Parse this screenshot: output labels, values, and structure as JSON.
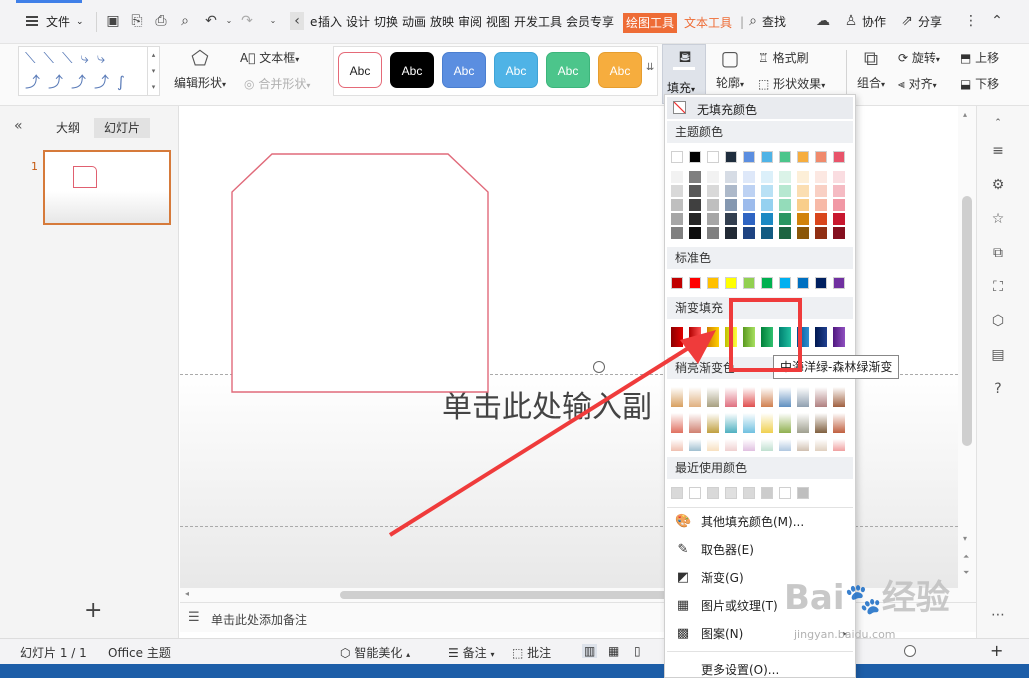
{
  "menubar": {
    "file_label": "文件",
    "tabs": [
      "插入",
      "设计",
      "切换",
      "动画",
      "放映",
      "审阅",
      "视图",
      "开发工具",
      "会员专享"
    ],
    "active_tab": "绘图工具",
    "text_tool_tab": "文本工具",
    "search_label": "查找",
    "collab_label": "协作",
    "share_label": "分享"
  },
  "ribbon": {
    "edit_shape_label": "编辑形状",
    "textbox_label": "文本框",
    "merge_shape_label": "合并形状",
    "style_buttons": [
      {
        "label": "Abc",
        "bg": "#ffffff",
        "color": "#222222",
        "border": "#e56a78"
      },
      {
        "label": "Abc",
        "bg": "#000000",
        "color": "#ffffff",
        "border": "#000000"
      },
      {
        "label": "Abc",
        "bg": "#5b8ee0",
        "color": "#ffffff",
        "border": "#4a7ed0"
      },
      {
        "label": "Abc",
        "bg": "#4fb3e6",
        "color": "#ffffff",
        "border": "#3fa3d6"
      },
      {
        "label": "Abc",
        "bg": "#4cc58b",
        "color": "#ffffff",
        "border": "#3cb57b"
      },
      {
        "label": "Abc",
        "bg": "#f6ad3e",
        "color": "#ffffff",
        "border": "#e69d2e"
      }
    ],
    "fill_label": "填充",
    "outline_label": "轮廓",
    "format_painter_label": "格式刷",
    "shape_effect_label": "形状效果",
    "group_label": "组合",
    "rotate_label": "旋转",
    "align_label": "对齐",
    "bring_up_label": "上移",
    "send_down_label": "下移"
  },
  "left_panel": {
    "outline_tab": "大纲",
    "slides_tab": "幻灯片",
    "slide_number": "1"
  },
  "canvas": {
    "subtitle_placeholder": "单击此处输入副"
  },
  "notes": {
    "placeholder": "单击此处添加备注"
  },
  "statusbar": {
    "slide_count": "幻灯片 1 / 1",
    "theme": "Office 主题",
    "smart_beautify": "智能美化",
    "notes_label": "备注",
    "comments_label": "批注"
  },
  "fill_menu": {
    "no_fill": "无填充颜色",
    "theme_colors_header": "主题颜色",
    "theme_top_row": [
      "#ffffff",
      "#000000",
      "#ffffff",
      "#1f2d3d",
      "#5b8ee0",
      "#4fb3e6",
      "#4cc58b",
      "#f6ad3e",
      "#f08a6c",
      "#e8546a"
    ],
    "theme_columns": [
      [
        "#f2f2f2",
        "#d9d9d9",
        "#bfbfbf",
        "#a6a6a6",
        "#808080"
      ],
      [
        "#7f7f7f",
        "#595959",
        "#404040",
        "#262626",
        "#0d0d0d"
      ],
      [
        "#f2f2f2",
        "#d9d9d9",
        "#bfbfbf",
        "#a6a6a6",
        "#808080"
      ],
      [
        "#d6dce5",
        "#adb9ca",
        "#8497b0",
        "#333f50",
        "#222a35"
      ],
      [
        "#dee8f9",
        "#bdd2f3",
        "#9cbbec",
        "#2e64c3",
        "#1e4382"
      ],
      [
        "#dcf0fa",
        "#b9e1f5",
        "#95d1f0",
        "#1b89c3",
        "#125b82"
      ],
      [
        "#dbf3e8",
        "#b7e8d1",
        "#94dcba",
        "#2a9662",
        "#1c6441"
      ],
      [
        "#fdefd8",
        "#fbdeb2",
        "#f9ce8b",
        "#d1820a",
        "#8b5707"
      ],
      [
        "#fce8e2",
        "#f9d0c4",
        "#f7b9a7",
        "#d9461c",
        "#912f13"
      ],
      [
        "#fadde1",
        "#f5bbc3",
        "#f198a5",
        "#c8182f",
        "#85101f"
      ]
    ],
    "standard_header": "标准色",
    "standard_colors": [
      "#c00000",
      "#ff0000",
      "#ffc000",
      "#ffff00",
      "#92d050",
      "#00b050",
      "#00b0f0",
      "#0070c0",
      "#002060",
      "#7030a0"
    ],
    "gradient_header": "渐变填充",
    "gradient_colors": [
      [
        "#8b0000",
        "#e00000"
      ],
      [
        "#b00000",
        "#ff5050"
      ],
      [
        "#d08000",
        "#ffd000"
      ],
      [
        "#c0c000",
        "#ffff40"
      ],
      [
        "#5a9a20",
        "#a8e060"
      ],
      [
        "#00803a",
        "#30c070"
      ],
      [
        "#008070",
        "#20c0a0"
      ],
      [
        "#005090",
        "#3090d0"
      ],
      [
        "#001850",
        "#204090"
      ],
      [
        "#501880",
        "#9050c0"
      ]
    ],
    "light_gradient_header": "稍亮渐变色",
    "light_gradient_rows": [
      [
        "#d8a060",
        "#e0b080",
        "#a8a080",
        "#e07080",
        "#e05050",
        "#d08050",
        "#6090c0",
        "#90a0b0",
        "#b08080",
        "#a06040"
      ],
      [
        "#e07060",
        "#d08070",
        "#c0a040",
        "#50b0c0",
        "#70c0e0",
        "#f0d050",
        "#90b050",
        "#a0a090",
        "#806040",
        "#c06040"
      ],
      [
        "#f0c0b0",
        "#a0c0d0",
        "#f8e0c0",
        "#f0d0d0",
        "#e0c0e0",
        "#c0e0d0",
        "#b0c8e0",
        "#d0c0b0",
        "#e0d0c0",
        "#f0a0a0"
      ]
    ],
    "recent_header": "最近使用颜色",
    "recent_colors": [
      "#d9d9d9",
      "#ffffff",
      "#d9d9d9",
      "#e0e0e0",
      "#d9d9d9",
      "#cccccc",
      "#ffffff",
      "#bfbfbf"
    ],
    "items": [
      {
        "icon": "palette-icon",
        "label": "其他填充颜色(M)..."
      },
      {
        "icon": "eyedropper-icon",
        "label": "取色器(E)"
      },
      {
        "icon": "gradient-icon",
        "label": "渐变(G)"
      },
      {
        "icon": "picture-texture-icon",
        "label": "图片或纹理(T)"
      },
      {
        "icon": "pattern-icon",
        "label": "图案(N)"
      }
    ],
    "more_settings": "更多设置(O)..."
  },
  "tooltip": "中海洋绿-森林绿渐变",
  "watermark": {
    "url": "jingyan.baidu.com"
  }
}
